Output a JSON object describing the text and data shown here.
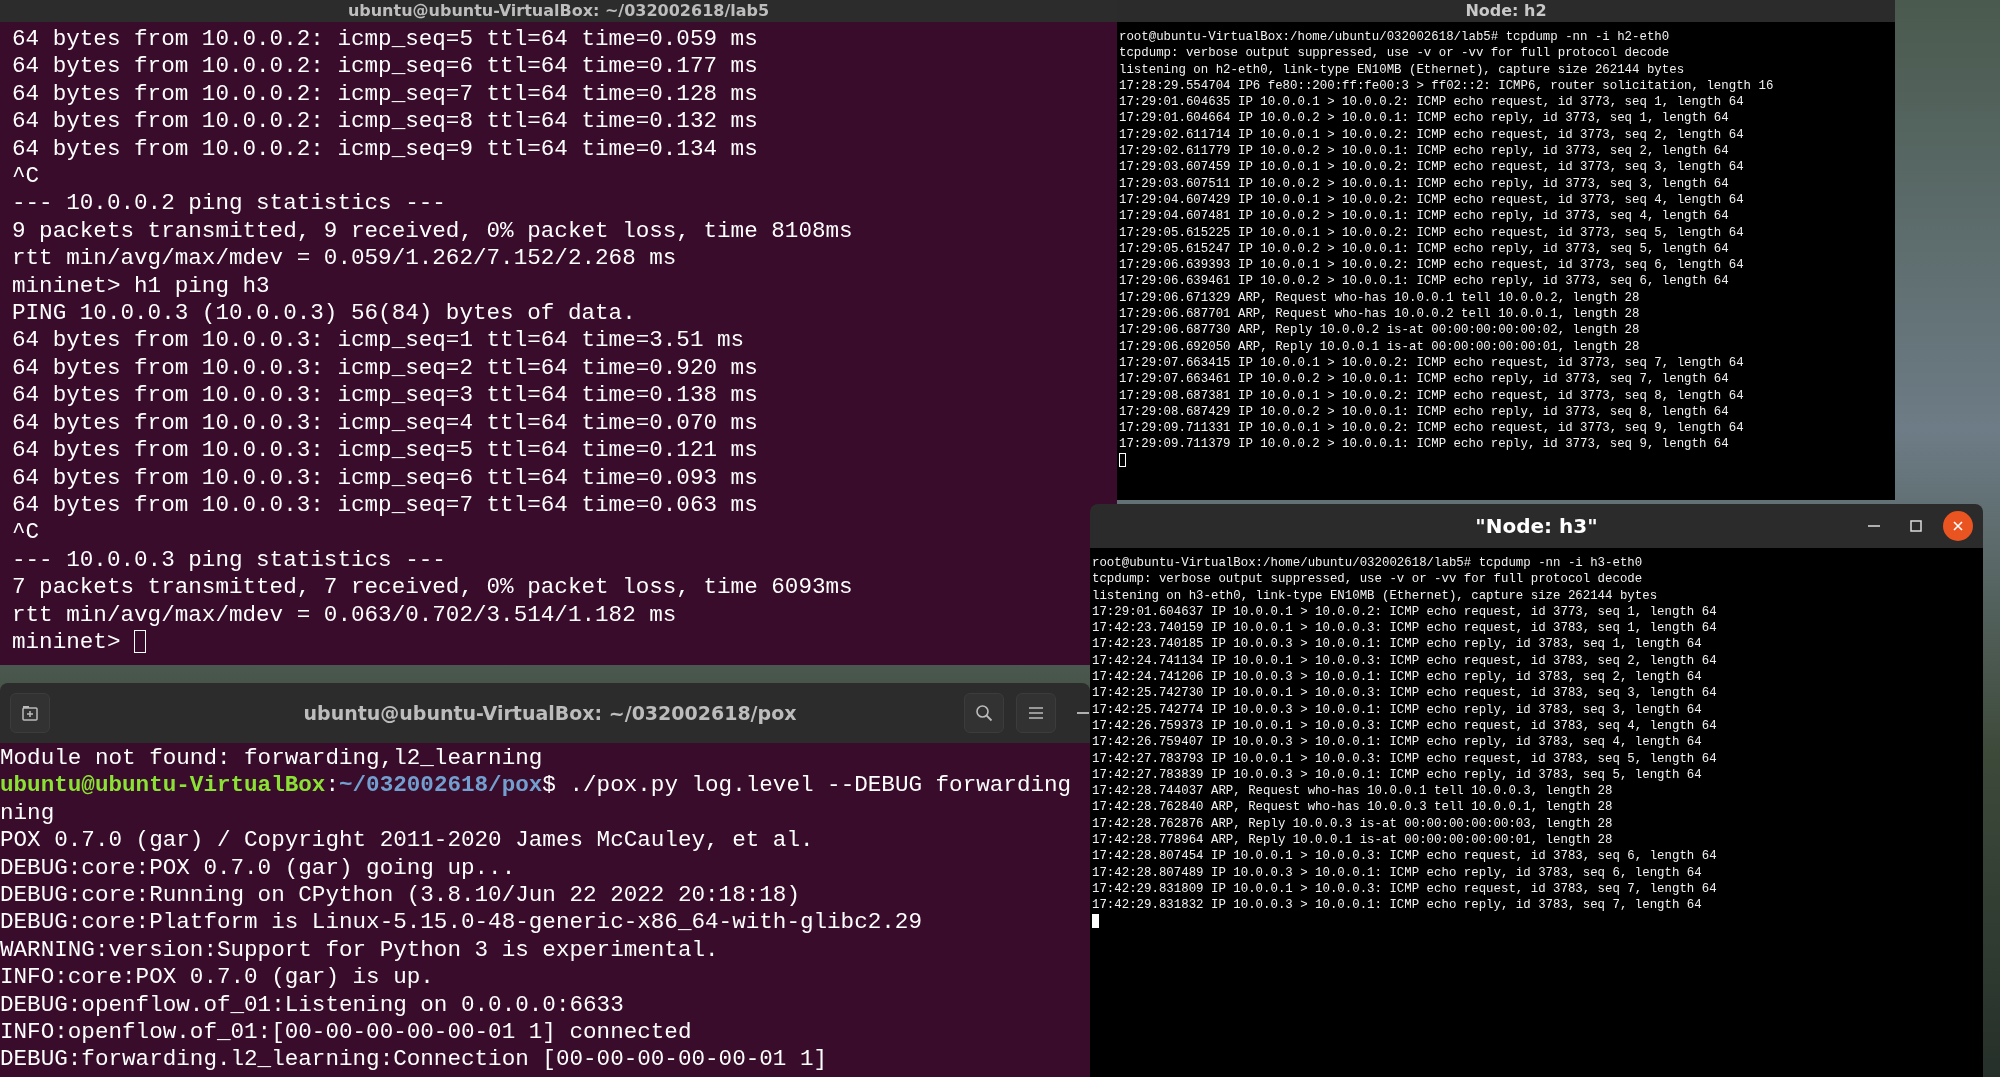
{
  "windows": [
    {
      "kind": "gnome-terminal",
      "title": "ubuntu@ubuntu-VirtualBox: ~/032002618/lab5",
      "lines": [
        "64 bytes from 10.0.0.2: icmp_seq=5 ttl=64 time=0.059 ms",
        "64 bytes from 10.0.0.2: icmp_seq=6 ttl=64 time=0.177 ms",
        "64 bytes from 10.0.0.2: icmp_seq=7 ttl=64 time=0.128 ms",
        "64 bytes from 10.0.0.2: icmp_seq=8 ttl=64 time=0.132 ms",
        "64 bytes from 10.0.0.2: icmp_seq=9 ttl=64 time=0.134 ms",
        "^C",
        "--- 10.0.0.2 ping statistics ---",
        "9 packets transmitted, 9 received, 0% packet loss, time 8108ms",
        "rtt min/avg/max/mdev = 0.059/1.262/7.152/2.268 ms",
        "mininet> h1 ping h3",
        "PING 10.0.0.3 (10.0.0.3) 56(84) bytes of data.",
        "64 bytes from 10.0.0.3: icmp_seq=1 ttl=64 time=3.51 ms",
        "64 bytes from 10.0.0.3: icmp_seq=2 ttl=64 time=0.920 ms",
        "64 bytes from 10.0.0.3: icmp_seq=3 ttl=64 time=0.138 ms",
        "64 bytes from 10.0.0.3: icmp_seq=4 ttl=64 time=0.070 ms",
        "64 bytes from 10.0.0.3: icmp_seq=5 ttl=64 time=0.121 ms",
        "64 bytes from 10.0.0.3: icmp_seq=6 ttl=64 time=0.093 ms",
        "64 bytes from 10.0.0.3: icmp_seq=7 ttl=64 time=0.063 ms",
        "^C",
        "--- 10.0.0.3 ping statistics ---",
        "7 packets transmitted, 7 received, 0% packet loss, time 6093ms",
        "rtt min/avg/max/mdev = 0.063/0.702/3.514/1.182 ms",
        "mininet> "
      ]
    },
    {
      "kind": "gnome-terminal",
      "title": "ubuntu@ubuntu-VirtualBox: ~/032002618/pox",
      "lines": [
        "Module not found: forwarding,l2_learning",
        {
          "parts": [
            {
              "kind": "user-host",
              "text": "ubuntu@ubuntu-VirtualBox"
            },
            {
              "kind": "plain",
              "text": ":"
            },
            {
              "kind": "path",
              "text": "~/032002618/pox"
            },
            {
              "kind": "plain",
              "text": "$ ./pox.py log.level --DEBUG forwarding"
            }
          ]
        },
        "ning",
        "POX 0.7.0 (gar) / Copyright 2011-2020 James McCauley, et al.",
        "DEBUG:core:POX 0.7.0 (gar) going up...",
        "DEBUG:core:Running on CPython (3.8.10/Jun 22 2022 20:18:18)",
        "DEBUG:core:Platform is Linux-5.15.0-48-generic-x86_64-with-glibc2.29",
        "WARNING:version:Support for Python 3 is experimental.",
        "INFO:core:POX 0.7.0 (gar) is up.",
        "DEBUG:openflow.of_01:Listening on 0.0.0.0:6633",
        "INFO:openflow.of_01:[00-00-00-00-00-01 1] connected",
        "DEBUG:forwarding.l2_learning:Connection [00-00-00-00-00-01 1]"
      ]
    },
    {
      "kind": "node-terminal",
      "title": "Node: h2",
      "lines": [
        "root@ubuntu-VirtualBox:/home/ubuntu/032002618/lab5# tcpdump -nn -i h2-eth0",
        "tcpdump: verbose output suppressed, use -v or -vv for full protocol decode",
        "listening on h2-eth0, link-type EN10MB (Ethernet), capture size 262144 bytes",
        "17:28:29.554704 IP6 fe80::200:ff:fe00:3 > ff02::2: ICMP6, router solicitation, length 16",
        "17:29:01.604635 IP 10.0.0.1 > 10.0.0.2: ICMP echo request, id 3773, seq 1, length 64",
        "17:29:01.604664 IP 10.0.0.2 > 10.0.0.1: ICMP echo reply, id 3773, seq 1, length 64",
        "17:29:02.611714 IP 10.0.0.1 > 10.0.0.2: ICMP echo request, id 3773, seq 2, length 64",
        "17:29:02.611779 IP 10.0.0.2 > 10.0.0.1: ICMP echo reply, id 3773, seq 2, length 64",
        "17:29:03.607459 IP 10.0.0.1 > 10.0.0.2: ICMP echo request, id 3773, seq 3, length 64",
        "17:29:03.607511 IP 10.0.0.2 > 10.0.0.1: ICMP echo reply, id 3773, seq 3, length 64",
        "17:29:04.607429 IP 10.0.0.1 > 10.0.0.2: ICMP echo request, id 3773, seq 4, length 64",
        "17:29:04.607481 IP 10.0.0.2 > 10.0.0.1: ICMP echo reply, id 3773, seq 4, length 64",
        "17:29:05.615225 IP 10.0.0.1 > 10.0.0.2: ICMP echo request, id 3773, seq 5, length 64",
        "17:29:05.615247 IP 10.0.0.2 > 10.0.0.1: ICMP echo reply, id 3773, seq 5, length 64",
        "17:29:06.639393 IP 10.0.0.1 > 10.0.0.2: ICMP echo request, id 3773, seq 6, length 64",
        "17:29:06.639461 IP 10.0.0.2 > 10.0.0.1: ICMP echo reply, id 3773, seq 6, length 64",
        "17:29:06.671329 ARP, Request who-has 10.0.0.1 tell 10.0.0.2, length 28",
        "17:29:06.687701 ARP, Request who-has 10.0.0.2 tell 10.0.0.1, length 28",
        "17:29:06.687730 ARP, Reply 10.0.0.2 is-at 00:00:00:00:00:02, length 28",
        "17:29:06.692050 ARP, Reply 10.0.0.1 is-at 00:00:00:00:00:01, length 28",
        "17:29:07.663415 IP 10.0.0.1 > 10.0.0.2: ICMP echo request, id 3773, seq 7, length 64",
        "17:29:07.663461 IP 10.0.0.2 > 10.0.0.1: ICMP echo reply, id 3773, seq 7, length 64",
        "17:29:08.687381 IP 10.0.0.1 > 10.0.0.2: ICMP echo request, id 3773, seq 8, length 64",
        "17:29:08.687429 IP 10.0.0.2 > 10.0.0.1: ICMP echo reply, id 3773, seq 8, length 64",
        "17:29:09.711331 IP 10.0.0.1 > 10.0.0.2: ICMP echo request, id 3773, seq 9, length 64",
        "17:29:09.711379 IP 10.0.0.2 > 10.0.0.1: ICMP echo reply, id 3773, seq 9, length 64"
      ]
    },
    {
      "kind": "node-terminal",
      "title": "\"Node: h3\"",
      "lines": [
        "root@ubuntu-VirtualBox:/home/ubuntu/032002618/lab5# tcpdump -nn -i h3-eth0",
        "tcpdump: verbose output suppressed, use -v or -vv for full protocol decode",
        "listening on h3-eth0, link-type EN10MB (Ethernet), capture size 262144 bytes",
        "17:29:01.604637 IP 10.0.0.1 > 10.0.0.2: ICMP echo request, id 3773, seq 1, length 64",
        "17:42:23.740159 IP 10.0.0.1 > 10.0.0.3: ICMP echo request, id 3783, seq 1, length 64",
        "17:42:23.740185 IP 10.0.0.3 > 10.0.0.1: ICMP echo reply, id 3783, seq 1, length 64",
        "17:42:24.741134 IP 10.0.0.1 > 10.0.0.3: ICMP echo request, id 3783, seq 2, length 64",
        "17:42:24.741206 IP 10.0.0.3 > 10.0.0.1: ICMP echo reply, id 3783, seq 2, length 64",
        "17:42:25.742730 IP 10.0.0.1 > 10.0.0.3: ICMP echo request, id 3783, seq 3, length 64",
        "17:42:25.742774 IP 10.0.0.3 > 10.0.0.1: ICMP echo reply, id 3783, seq 3, length 64",
        "17:42:26.759373 IP 10.0.0.1 > 10.0.0.3: ICMP echo request, id 3783, seq 4, length 64",
        "17:42:26.759407 IP 10.0.0.3 > 10.0.0.1: ICMP echo reply, id 3783, seq 4, length 64",
        "17:42:27.783793 IP 10.0.0.1 > 10.0.0.3: ICMP echo request, id 3783, seq 5, length 64",
        "17:42:27.783839 IP 10.0.0.3 > 10.0.0.1: ICMP echo reply, id 3783, seq 5, length 64",
        "17:42:28.744037 ARP, Request who-has 10.0.0.1 tell 10.0.0.3, length 28",
        "17:42:28.762840 ARP, Request who-has 10.0.0.3 tell 10.0.0.1, length 28",
        "17:42:28.762876 ARP, Reply 10.0.0.3 is-at 00:00:00:00:00:03, length 28",
        "17:42:28.778964 ARP, Reply 10.0.0.1 is-at 00:00:00:00:00:01, length 28",
        "17:42:28.807454 IP 10.0.0.1 > 10.0.0.3: ICMP echo request, id 3783, seq 6, length 64",
        "17:42:28.807489 IP 10.0.0.3 > 10.0.0.1: ICMP echo reply, id 3783, seq 6, length 64",
        "17:42:29.831809 IP 10.0.0.1 > 10.0.0.3: ICMP echo request, id 3783, seq 7, length 64",
        "17:42:29.831832 IP 10.0.0.3 > 10.0.0.1: ICMP echo reply, id 3783, seq 7, length 64"
      ]
    }
  ]
}
